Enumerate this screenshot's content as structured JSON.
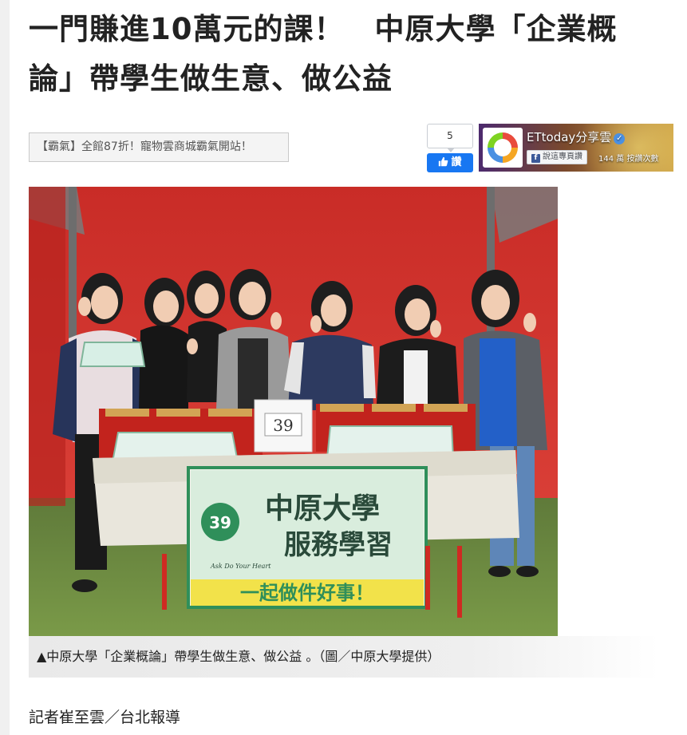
{
  "article": {
    "title_line1": "一門賺進10萬元的課！　中原大學「企業概",
    "title_line2": "論」帶學生做生意、做公益",
    "promo_link": "【霸氣】全館87折！寵物雲商城霸氣開站！",
    "photo_caption": "▲中原大學「企業概論」帶學生做生意、做公益 。（圖／中原大學提供）",
    "byline": "記者崔至雲／台北報導"
  },
  "like_widget": {
    "count": "5",
    "button_label": "讚"
  },
  "fb_page_plugin": {
    "page_name": "ETtoday分享雲",
    "verified_mark": "✓",
    "like_page_label": "說這專頁讚",
    "followers_text": "144 萬 按讚次數"
  },
  "photo_content": {
    "booth_number": "39",
    "banner_number": "39",
    "banner_line1": "中原大學",
    "banner_line2": "服務學習",
    "banner_slogan": "一起做件好事！",
    "banner_script": "Ask Do Your Heart"
  },
  "colors": {
    "like_blue": "#1877f2",
    "tent_red": "#d8352f",
    "banner_green": "#2f8f5a",
    "banner_yellow": "#f2e24a"
  }
}
